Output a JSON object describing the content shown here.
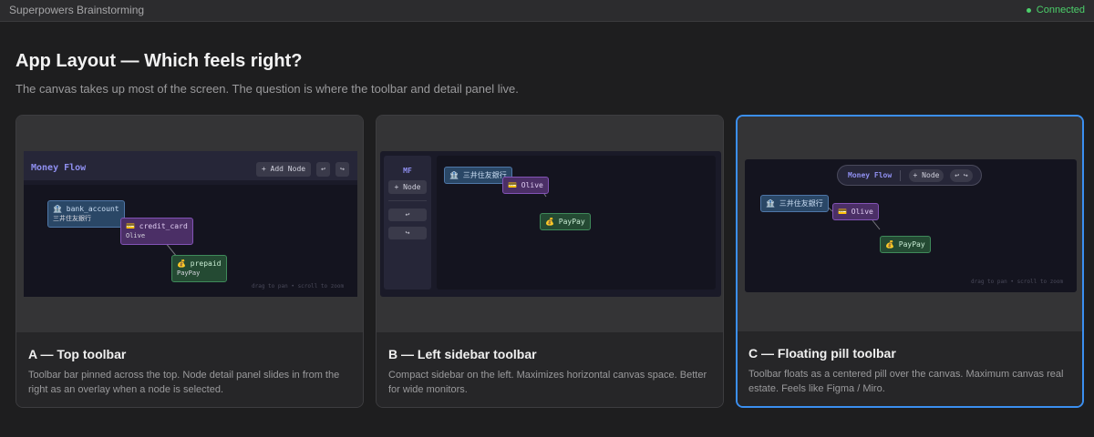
{
  "topbar": {
    "title": "Superpowers Brainstorming",
    "status": "Connected",
    "status_color": "#4ccf6a"
  },
  "page": {
    "title": "App Layout — Which feels right?",
    "subtitle": "The canvas takes up most of the screen. The question is where the toolbar and detail panel live."
  },
  "options": [
    {
      "title": "A — Top toolbar",
      "description": "Toolbar bar pinned across the top. Node detail panel slides in from the right as an overlay when a node is selected.",
      "selected": false,
      "preview": {
        "brand": "Money Flow",
        "add_node": "+ Add Node",
        "undo": "↩",
        "redo": "↪",
        "bank_name": "🏦 bank_account",
        "bank_sub": "三井住友銀行",
        "credit_name": "💳 credit_card",
        "credit_sub": "Olive",
        "prepaid_name": "💰 prepaid",
        "prepaid_sub": "PayPay",
        "hint": "drag to pan • scroll to zoom"
      }
    },
    {
      "title": "B — Left sidebar toolbar",
      "description": "Compact sidebar on the left. Maximizes horizontal canvas space. Better for wide monitors.",
      "selected": false,
      "preview": {
        "brand": "MF",
        "add_node": "+ Node",
        "undo": "↩",
        "redo": "↪",
        "bank_name": "🏦 三井住友銀行",
        "credit_name": "💳 Olive",
        "prepaid_name": "💰 PayPay"
      }
    },
    {
      "title": "C — Floating pill toolbar",
      "description": "Toolbar floats as a centered pill over the canvas. Maximum canvas real estate. Feels like Figma / Miro.",
      "selected": true,
      "preview": {
        "brand": "Money Flow",
        "add_node": "+ Node",
        "undo_redo": "↩ ↪",
        "bank_name": "🏦 三井住友銀行",
        "credit_name": "💳 Olive",
        "prepaid_name": "💰 PayPay",
        "hint": "drag to pan • scroll to zoom"
      }
    }
  ],
  "colors": {
    "accent": "#3b8ff0",
    "bank": "#4f77a8",
    "credit": "#8353b6",
    "prepaid": "#3f8a5a"
  }
}
